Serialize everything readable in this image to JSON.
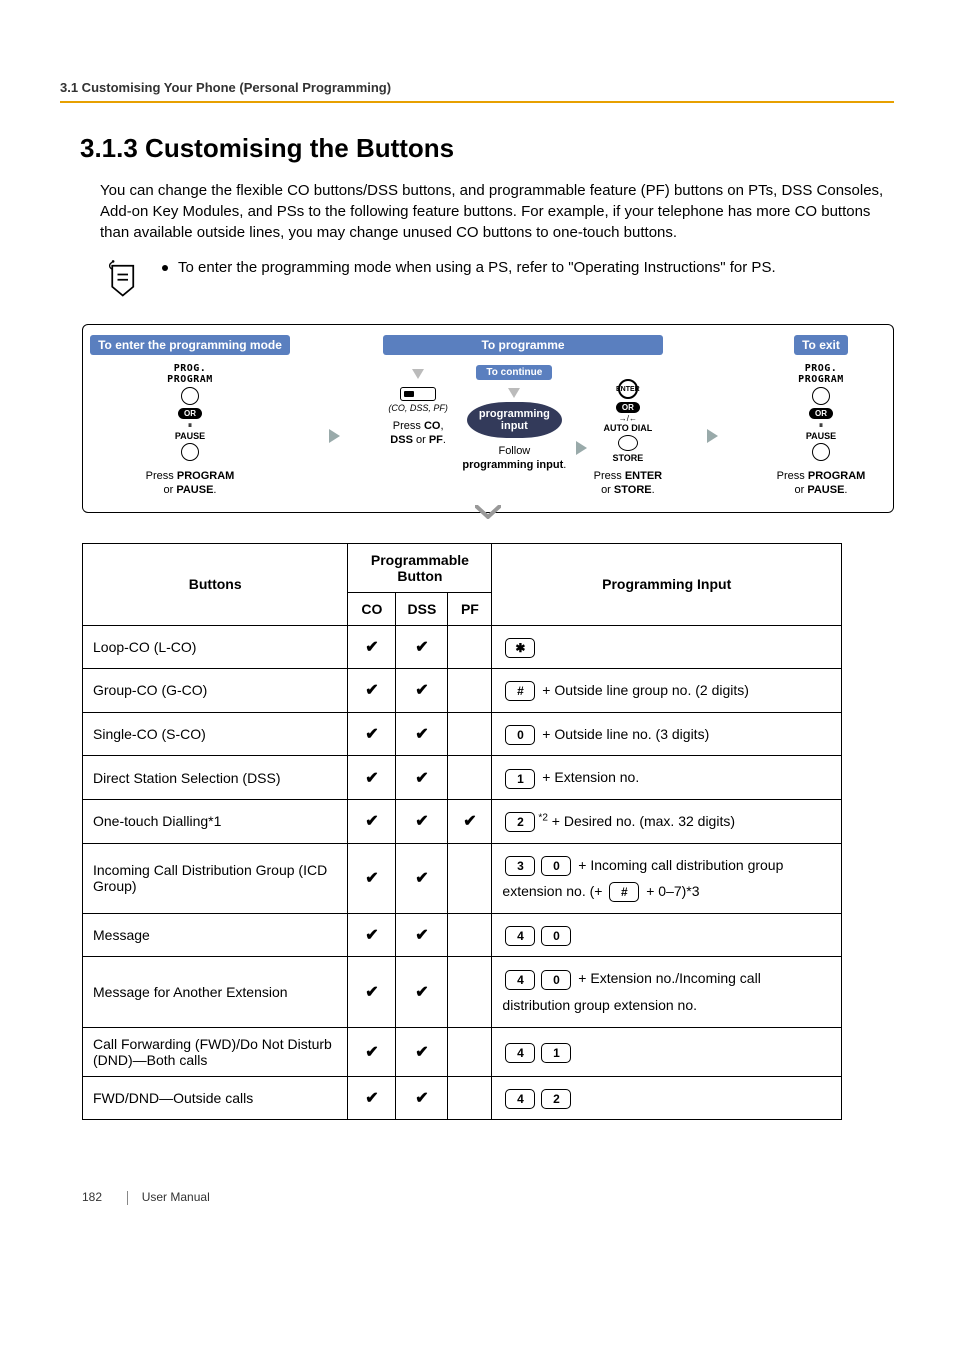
{
  "header": {
    "breadcrumb": "3.1 Customising Your Phone (Personal Programming)"
  },
  "heading": "3.1.3    Customising the Buttons",
  "intro": "You can change the flexible CO buttons/DSS buttons, and programmable feature (PF) buttons on PTs, DSS Consoles, Add-on Key Modules, and PSs to the following feature buttons. For example, if your telephone has more CO buttons than available outside lines, you may change unused CO buttons to one-touch buttons.",
  "note": "To enter the programming mode when using a PS, refer to \"Operating Instructions\" for PS.",
  "flow": {
    "enter_header": "To enter the programming mode",
    "prog_header": "To programme",
    "continue_header": "To continue",
    "exit_header": "To exit",
    "prog_label1": "PROG.",
    "prog_label2": "PROGRAM",
    "or": "OR",
    "pause": "PAUSE",
    "co_label": "(CO, DSS, PF)",
    "pill1": "programming",
    "pill2": "input",
    "enter_label": "ENTER",
    "autodial": "AUTO DIAL",
    "store": "STORE",
    "cap_enter": "Press PROGRAM or PAUSE.",
    "cap_co": "Press CO, DSS or PF.",
    "cap_follow": "Follow programming input.",
    "cap_store": "Press ENTER or STORE.",
    "cap_exit": "Press PROGRAM or PAUSE."
  },
  "table": {
    "h_buttons": "Buttons",
    "h_prog": "Programmable Button",
    "h_co": "CO",
    "h_dss": "DSS",
    "h_pf": "PF",
    "h_input": "Programming Input",
    "rows": [
      {
        "name": "Loop-CO (L-CO)",
        "co": "✔",
        "dss": "✔",
        "pf": "",
        "keys": [
          "✱"
        ],
        "suffix": ""
      },
      {
        "name": "Group-CO (G-CO)",
        "co": "✔",
        "dss": "✔",
        "pf": "",
        "keys": [
          "#"
        ],
        "suffix": " + Outside line group no. (2 digits)"
      },
      {
        "name": "Single-CO (S-CO)",
        "co": "✔",
        "dss": "✔",
        "pf": "",
        "keys": [
          "0"
        ],
        "suffix": " + Outside line no. (3 digits)"
      },
      {
        "name": "Direct Station Selection (DSS)",
        "co": "✔",
        "dss": "✔",
        "pf": "",
        "keys": [
          "1"
        ],
        "suffix": " + Extension no."
      },
      {
        "name": "One-touch Dialling*1",
        "co": "✔",
        "dss": "✔",
        "pf": "✔",
        "keys": [
          "2"
        ],
        "sup": "*2",
        "suffix": " + Desired no. (max. 32 digits)"
      },
      {
        "name": "Incoming Call Distribution Group (ICD Group)",
        "co": "✔",
        "dss": "✔",
        "pf": "",
        "keys": [
          "3",
          "0"
        ],
        "suffix_pre": " + Incoming call distribution group extension no. (+ ",
        "inline_key": "#",
        "suffix_post": " + 0–7)*3"
      },
      {
        "name": "Message",
        "co": "✔",
        "dss": "✔",
        "pf": "",
        "keys": [
          "4",
          "0"
        ],
        "suffix": ""
      },
      {
        "name": "Message for Another Extension",
        "co": "✔",
        "dss": "✔",
        "pf": "",
        "keys": [
          "4",
          "0"
        ],
        "suffix": " + Extension no./Incoming call distribution group extension no."
      },
      {
        "name": "Call Forwarding (FWD)/Do Not Disturb (DND)—Both calls",
        "co": "✔",
        "dss": "✔",
        "pf": "",
        "keys": [
          "4",
          "1"
        ],
        "suffix": ""
      },
      {
        "name": "FWD/DND—Outside calls",
        "co": "✔",
        "dss": "✔",
        "pf": "",
        "keys": [
          "4",
          "2"
        ],
        "suffix": ""
      }
    ]
  },
  "footer": {
    "page": "182",
    "title": "User Manual"
  }
}
